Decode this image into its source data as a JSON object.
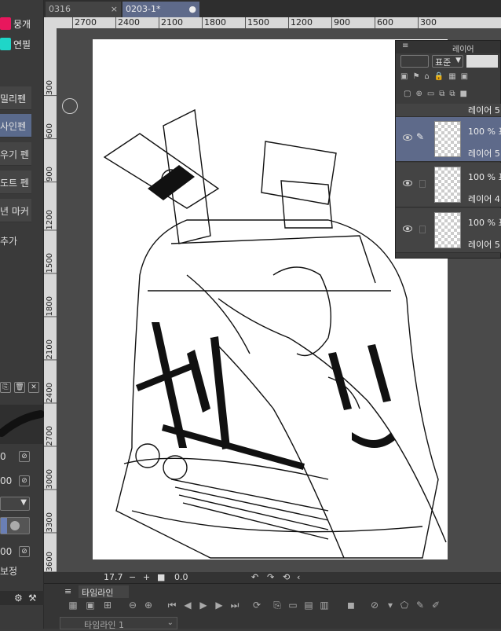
{
  "tabs": [
    {
      "label": "0316",
      "close": "×"
    },
    {
      "label": "0203-1*",
      "close": "●"
    }
  ],
  "left_panel": {
    "swatches": [
      {
        "label": "뭉개",
        "color": "#e8175d"
      },
      {
        "label": "연필",
        "color": "#1fd6c8"
      }
    ],
    "tools": [
      {
        "label": "밀리펜",
        "selected": false
      },
      {
        "label": "사인펜",
        "selected": true
      },
      {
        "label": "우기 펜",
        "selected": false
      },
      {
        "label": "도트 펜",
        "selected": false
      },
      {
        "label": "년 마커",
        "selected": false
      }
    ],
    "add_label": "추가",
    "values": [
      "0",
      "00",
      "00"
    ],
    "correction_label": "보정"
  },
  "ruler": {
    "h": [
      "2700",
      "2400",
      "2100",
      "1800",
      "1500",
      "1200",
      "900",
      "600",
      "300"
    ],
    "v": [
      "300",
      "600",
      "900",
      "1200",
      "1500",
      "1800",
      "2100",
      "2400",
      "2700",
      "3000",
      "3300",
      "3600"
    ]
  },
  "layers_panel": {
    "title": "레이어",
    "blend_mode": "표준",
    "layers": [
      {
        "opacity": "",
        "name": "레이어 5",
        "selected": false,
        "partial": true
      },
      {
        "opacity": "100 % 표",
        "name": "레이어 5",
        "selected": true
      },
      {
        "opacity": "100 % 표",
        "name": "레이어 4",
        "selected": false
      },
      {
        "opacity": "100 % 표",
        "name": "레이어 5",
        "selected": false
      }
    ]
  },
  "status": {
    "zoom": "17.7",
    "rotation": "0.0"
  },
  "timeline": {
    "tab_label": "타임라인",
    "select_value": "타임라인 1"
  }
}
